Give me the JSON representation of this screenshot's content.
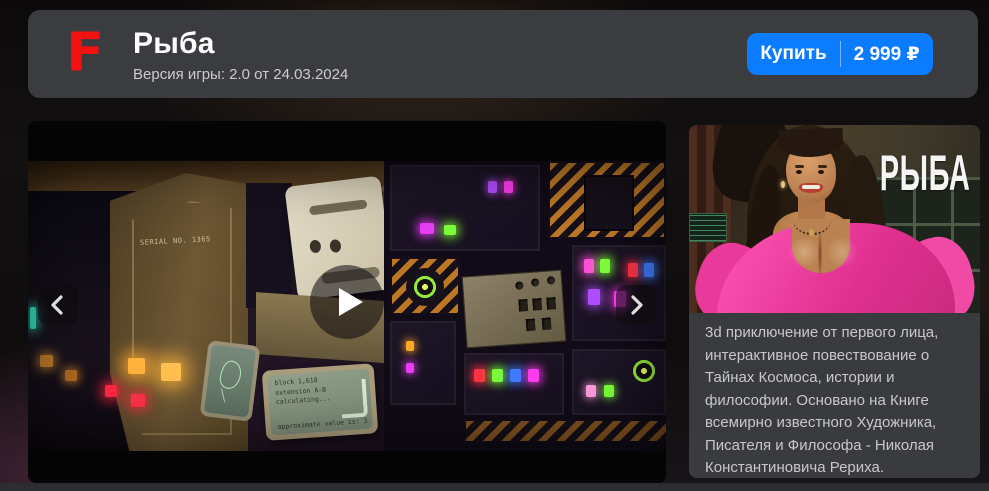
{
  "header": {
    "logo_letter": "F",
    "title": "Рыба",
    "version": "Версия игры: 2.0 от 24.03.2024",
    "buy": {
      "label": "Купить",
      "price": "2 999 ₽"
    }
  },
  "player": {
    "scene": {
      "serial": "SERIAL NO. 1365",
      "screen": {
        "lines": [
          "block 1,618",
          "extension A-B",
          "calculating..."
        ],
        "footer": "approximate value is: 3"
      }
    }
  },
  "cover": {
    "title": "РЫБА"
  },
  "about": {
    "description": "3d приключение от первого лица, интерактивное повествование о Тайнах Космоса, истории и философии. Основано на Книге всемирно известного Художника, Писателя и Философа - Николая Константиновича Рериха."
  },
  "icons": {
    "logo": "f-logo",
    "play": "play-icon",
    "prev": "chevron-left-icon",
    "next": "chevron-right-icon"
  },
  "colors": {
    "accent_blue": "#0b7bff",
    "logo_red": "#f31111",
    "header_bg": "#3b3c40",
    "panel_bg": "#3a3b3f",
    "cover_pink": "#e0308f"
  }
}
